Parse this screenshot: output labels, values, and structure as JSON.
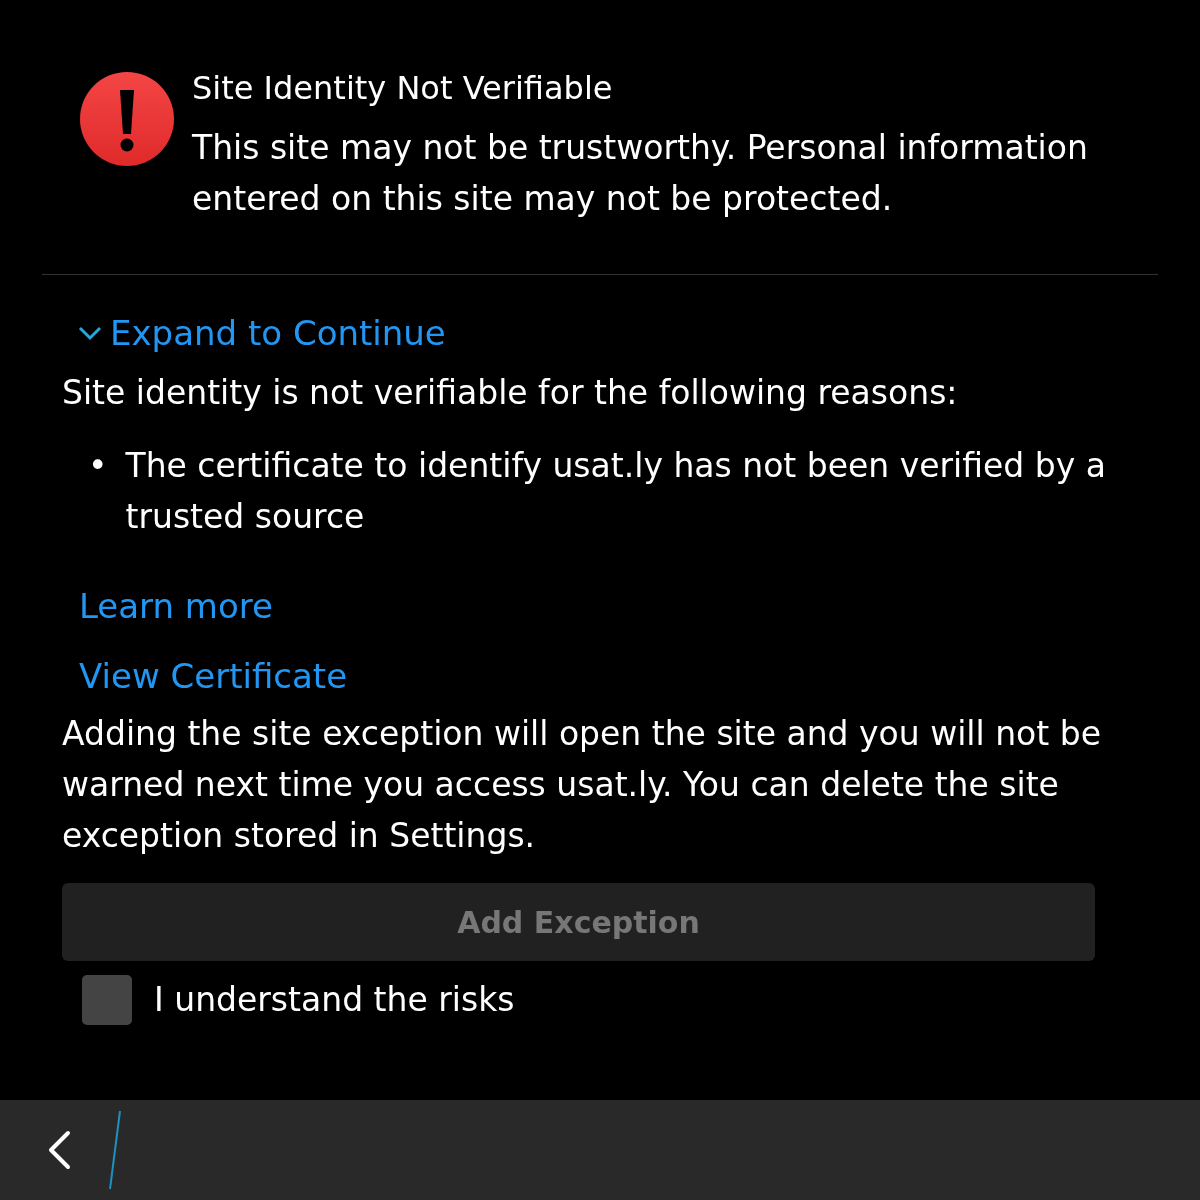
{
  "warning": {
    "title": "Site Identity Not Verifiable",
    "message": "This site may not be trustworthy. Personal information entered on this site may not be protected."
  },
  "expander": {
    "label": "Expand to Continue",
    "expanded": true
  },
  "details": {
    "intro": "Site identity is not verifiable for the following reasons:",
    "reasons": [
      {
        "bullet": "•",
        "text": "The certificate to identify usat.ly has not been verified by a trusted source"
      }
    ],
    "links": [
      "Learn more",
      "View Certificate"
    ],
    "note": "Adding the site exception will open the site and you will not be warned next time you access usat.ly. You can delete the site exception stored in Settings.",
    "button": {
      "label": "Add Exception",
      "disabled": true
    },
    "checkbox": {
      "label": "I understand the risks",
      "checked": false
    }
  }
}
